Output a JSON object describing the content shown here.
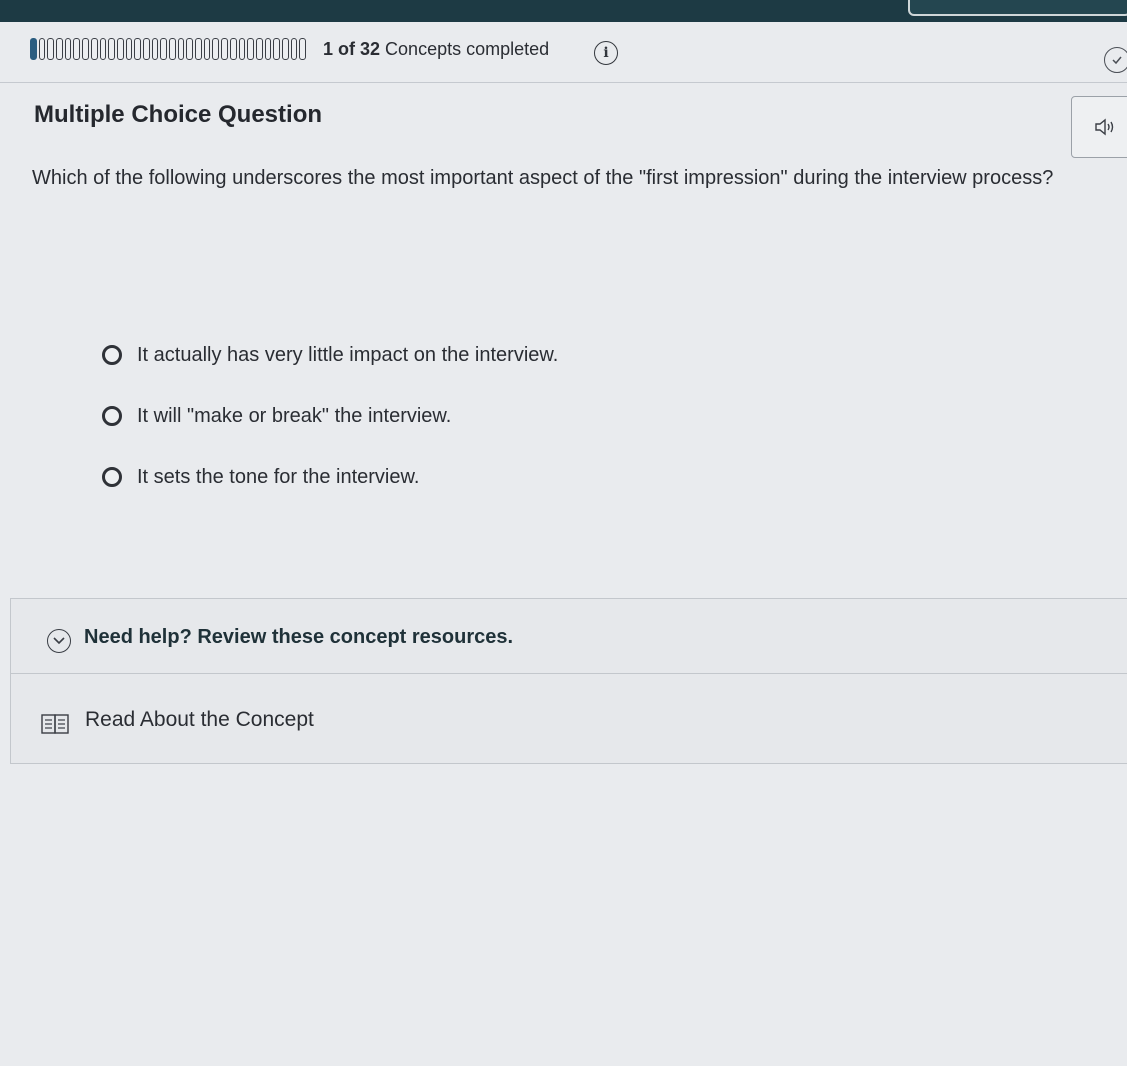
{
  "progress": {
    "completed": 1,
    "total": 32,
    "count_label": "1 of 32",
    "suffix": "Concepts completed"
  },
  "info": {
    "glyph": "i"
  },
  "question": {
    "type": "Multiple Choice Question",
    "text": "Which of the following underscores the most important aspect of the \"first impression\" during the interview process?",
    "options": [
      "It actually has very little impact on the interview.",
      "It will \"make or break\" the interview.",
      "It sets the tone for the interview."
    ]
  },
  "help": {
    "title": "Need help? Review these concept resources.",
    "resources": [
      "Read About the Concept"
    ]
  },
  "icons": {
    "info": "info-icon",
    "audio": "speaker-icon",
    "check": "check-circle-icon",
    "expand": "chevron-down-icon",
    "resource": "book-icon"
  },
  "colors": {
    "progress_fill": "#2b5d80",
    "top_bar": "#1d3a44",
    "help_title": "#1f3138"
  }
}
